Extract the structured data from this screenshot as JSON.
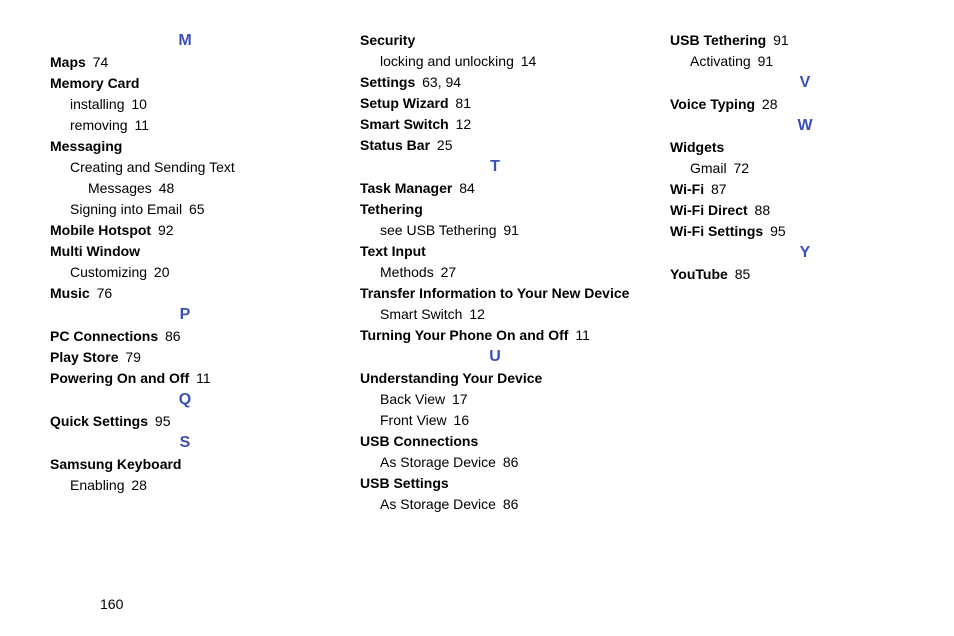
{
  "page_number": "160",
  "columns": [
    {
      "id": "col1",
      "sections": [
        {
          "letter": "M",
          "entries": [
            {
              "term": "Maps",
              "page": "74"
            },
            {
              "term": "Memory Card",
              "subs": [
                {
                  "text": "installing",
                  "page": "10"
                },
                {
                  "text": "removing",
                  "page": "11"
                }
              ]
            },
            {
              "term": "Messaging",
              "subs": [
                {
                  "text": "Creating and Sending Text",
                  "cont": "Messages",
                  "page": "48"
                },
                {
                  "text": "Signing into Email",
                  "page": "65"
                }
              ]
            },
            {
              "term": "Mobile Hotspot",
              "page": "92"
            },
            {
              "term": "Multi Window",
              "subs": [
                {
                  "text": "Customizing",
                  "page": "20"
                }
              ]
            },
            {
              "term": "Music",
              "page": "76"
            }
          ]
        },
        {
          "letter": "P",
          "entries": [
            {
              "term": "PC Connections",
              "page": "86"
            },
            {
              "term": "Play Store",
              "page": "79"
            },
            {
              "term": "Powering On and Off",
              "page": "11"
            }
          ]
        },
        {
          "letter": "Q",
          "entries": [
            {
              "term": "Quick Settings",
              "page": "95"
            }
          ]
        },
        {
          "letter": "S",
          "entries": [
            {
              "term": "Samsung Keyboard",
              "subs": [
                {
                  "text": "Enabling",
                  "page": "28"
                }
              ]
            }
          ]
        }
      ]
    },
    {
      "id": "col2",
      "sections": [
        {
          "letter": null,
          "entries": [
            {
              "term": "Security",
              "subs": [
                {
                  "text": "locking and unlocking",
                  "page": "14"
                }
              ]
            },
            {
              "term": "Settings",
              "page": "63, 94"
            },
            {
              "term": "Setup Wizard",
              "page": "81"
            },
            {
              "term": "Smart Switch",
              "page": "12"
            },
            {
              "term": "Status Bar",
              "page": "25"
            }
          ]
        },
        {
          "letter": "T",
          "entries": [
            {
              "term": "Task Manager",
              "page": "84"
            },
            {
              "term": "Tethering",
              "subs": [
                {
                  "text": "see USB Tethering",
                  "page": "91"
                }
              ]
            },
            {
              "term": "Text Input",
              "subs": [
                {
                  "text": "Methods",
                  "page": "27"
                }
              ]
            },
            {
              "term": "Transfer Information to Your New Device",
              "term_wrap": true,
              "subs": [
                {
                  "text": "Smart Switch",
                  "page": "12"
                }
              ]
            },
            {
              "term": "Turning Your Phone On and Off",
              "page": "11"
            }
          ]
        },
        {
          "letter": "U",
          "entries": [
            {
              "term": "Understanding Your Device",
              "subs": [
                {
                  "text": "Back View",
                  "page": "17"
                },
                {
                  "text": "Front View",
                  "page": "16"
                }
              ]
            },
            {
              "term": "USB Connections",
              "subs": [
                {
                  "text": "As Storage Device",
                  "page": "86"
                }
              ]
            },
            {
              "term": "USB Settings",
              "subs": [
                {
                  "text": "As Storage Device",
                  "page": "86"
                }
              ]
            }
          ]
        }
      ]
    },
    {
      "id": "col3",
      "sections": [
        {
          "letter": null,
          "entries": [
            {
              "term": "USB Tethering",
              "page": "91",
              "subs": [
                {
                  "text": "Activating",
                  "page": "91"
                }
              ]
            }
          ]
        },
        {
          "letter": "V",
          "entries": [
            {
              "term": "Voice Typing",
              "page": "28"
            }
          ]
        },
        {
          "letter": "W",
          "entries": [
            {
              "term": "Widgets",
              "subs": [
                {
                  "text": "Gmail",
                  "page": "72"
                }
              ]
            },
            {
              "term": "Wi-Fi",
              "page": "87"
            },
            {
              "term": "Wi-Fi Direct",
              "page": "88"
            },
            {
              "term": "Wi-Fi Settings",
              "page": "95"
            }
          ]
        },
        {
          "letter": "Y",
          "entries": [
            {
              "term": "YouTube",
              "page": "85"
            }
          ]
        }
      ]
    }
  ]
}
